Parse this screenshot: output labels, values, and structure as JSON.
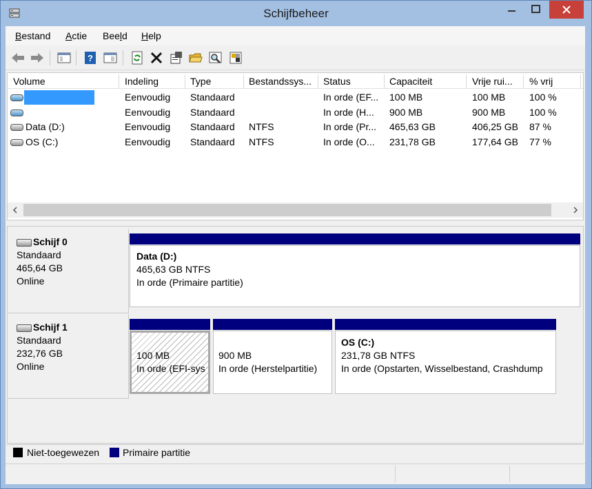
{
  "window": {
    "title": "Schijfbeheer"
  },
  "menu": {
    "items": [
      {
        "label": "Bestand",
        "key": "B",
        "rest": "estand"
      },
      {
        "label": "Actie",
        "key": "A",
        "rest": "ctie"
      },
      {
        "label": "Beeld",
        "pre": "Bee",
        "key": "l",
        "rest": "d"
      },
      {
        "label": "Help",
        "key": "H",
        "rest": "elp"
      }
    ]
  },
  "toolbar": {
    "icons": [
      "back-arrow-icon",
      "forward-arrow-icon",
      "show-hide-console-tree-icon",
      "help-icon",
      "properties-pane-icon",
      "refresh-icon",
      "delete-icon",
      "properties-icon",
      "open-folder-icon",
      "search-icon",
      "settings-icon"
    ]
  },
  "volumes": {
    "columns": [
      "Volume",
      "Indeling",
      "Type",
      "Bestandssys...",
      "Status",
      "Capaciteit",
      "Vrije rui...",
      "% vrij"
    ],
    "rows": [
      {
        "volume": "",
        "selected": true,
        "indeling": "Eenvoudig",
        "type": "Standaard",
        "fs": "",
        "status": "In orde (EF...",
        "capacity": "100 MB",
        "free": "100 MB",
        "pct": "100 %"
      },
      {
        "volume": "",
        "selected": false,
        "indeling": "Eenvoudig",
        "type": "Standaard",
        "fs": "",
        "status": "In orde (H...",
        "capacity": "900 MB",
        "free": "900 MB",
        "pct": "100 %"
      },
      {
        "volume": "Data (D:)",
        "selected": false,
        "indeling": "Eenvoudig",
        "type": "Standaard",
        "fs": "NTFS",
        "status": "In orde (Pr...",
        "capacity": "465,63 GB",
        "free": "406,25 GB",
        "pct": "87 %"
      },
      {
        "volume": "OS (C:)",
        "selected": false,
        "indeling": "Eenvoudig",
        "type": "Standaard",
        "fs": "NTFS",
        "status": "In orde (O...",
        "capacity": "231,78 GB",
        "free": "177,64 GB",
        "pct": "77 %"
      }
    ]
  },
  "disks": [
    {
      "name": "Schijf 0",
      "type": "Standaard",
      "size": "465,64 GB",
      "state": "Online",
      "partitions": [
        {
          "name": "Data  (D:)",
          "size": "465,63 GB NTFS",
          "status": "In orde (Primaire partitie)"
        }
      ]
    },
    {
      "name": "Schijf 1",
      "type": "Standaard",
      "size": "232,76 GB",
      "state": "Online",
      "partitions": [
        {
          "name": "",
          "size": "100 MB",
          "status": "In orde (EFI-sys"
        },
        {
          "name": "",
          "size": "900 MB",
          "status": "In orde (Herstelpartitie)"
        },
        {
          "name": "OS  (C:)",
          "size": "231,78 GB NTFS",
          "status": "In orde (Opstarten, Wisselbestand, Crashdump"
        }
      ]
    }
  ],
  "legend": {
    "unallocated": "Niet-toegewezen",
    "primary": "Primaire partitie",
    "unallocated_color": "#000000",
    "primary_color": "#00007f"
  },
  "colors": {
    "accent": "#00007f",
    "selection": "#3399ff",
    "close": "#c7413a"
  }
}
